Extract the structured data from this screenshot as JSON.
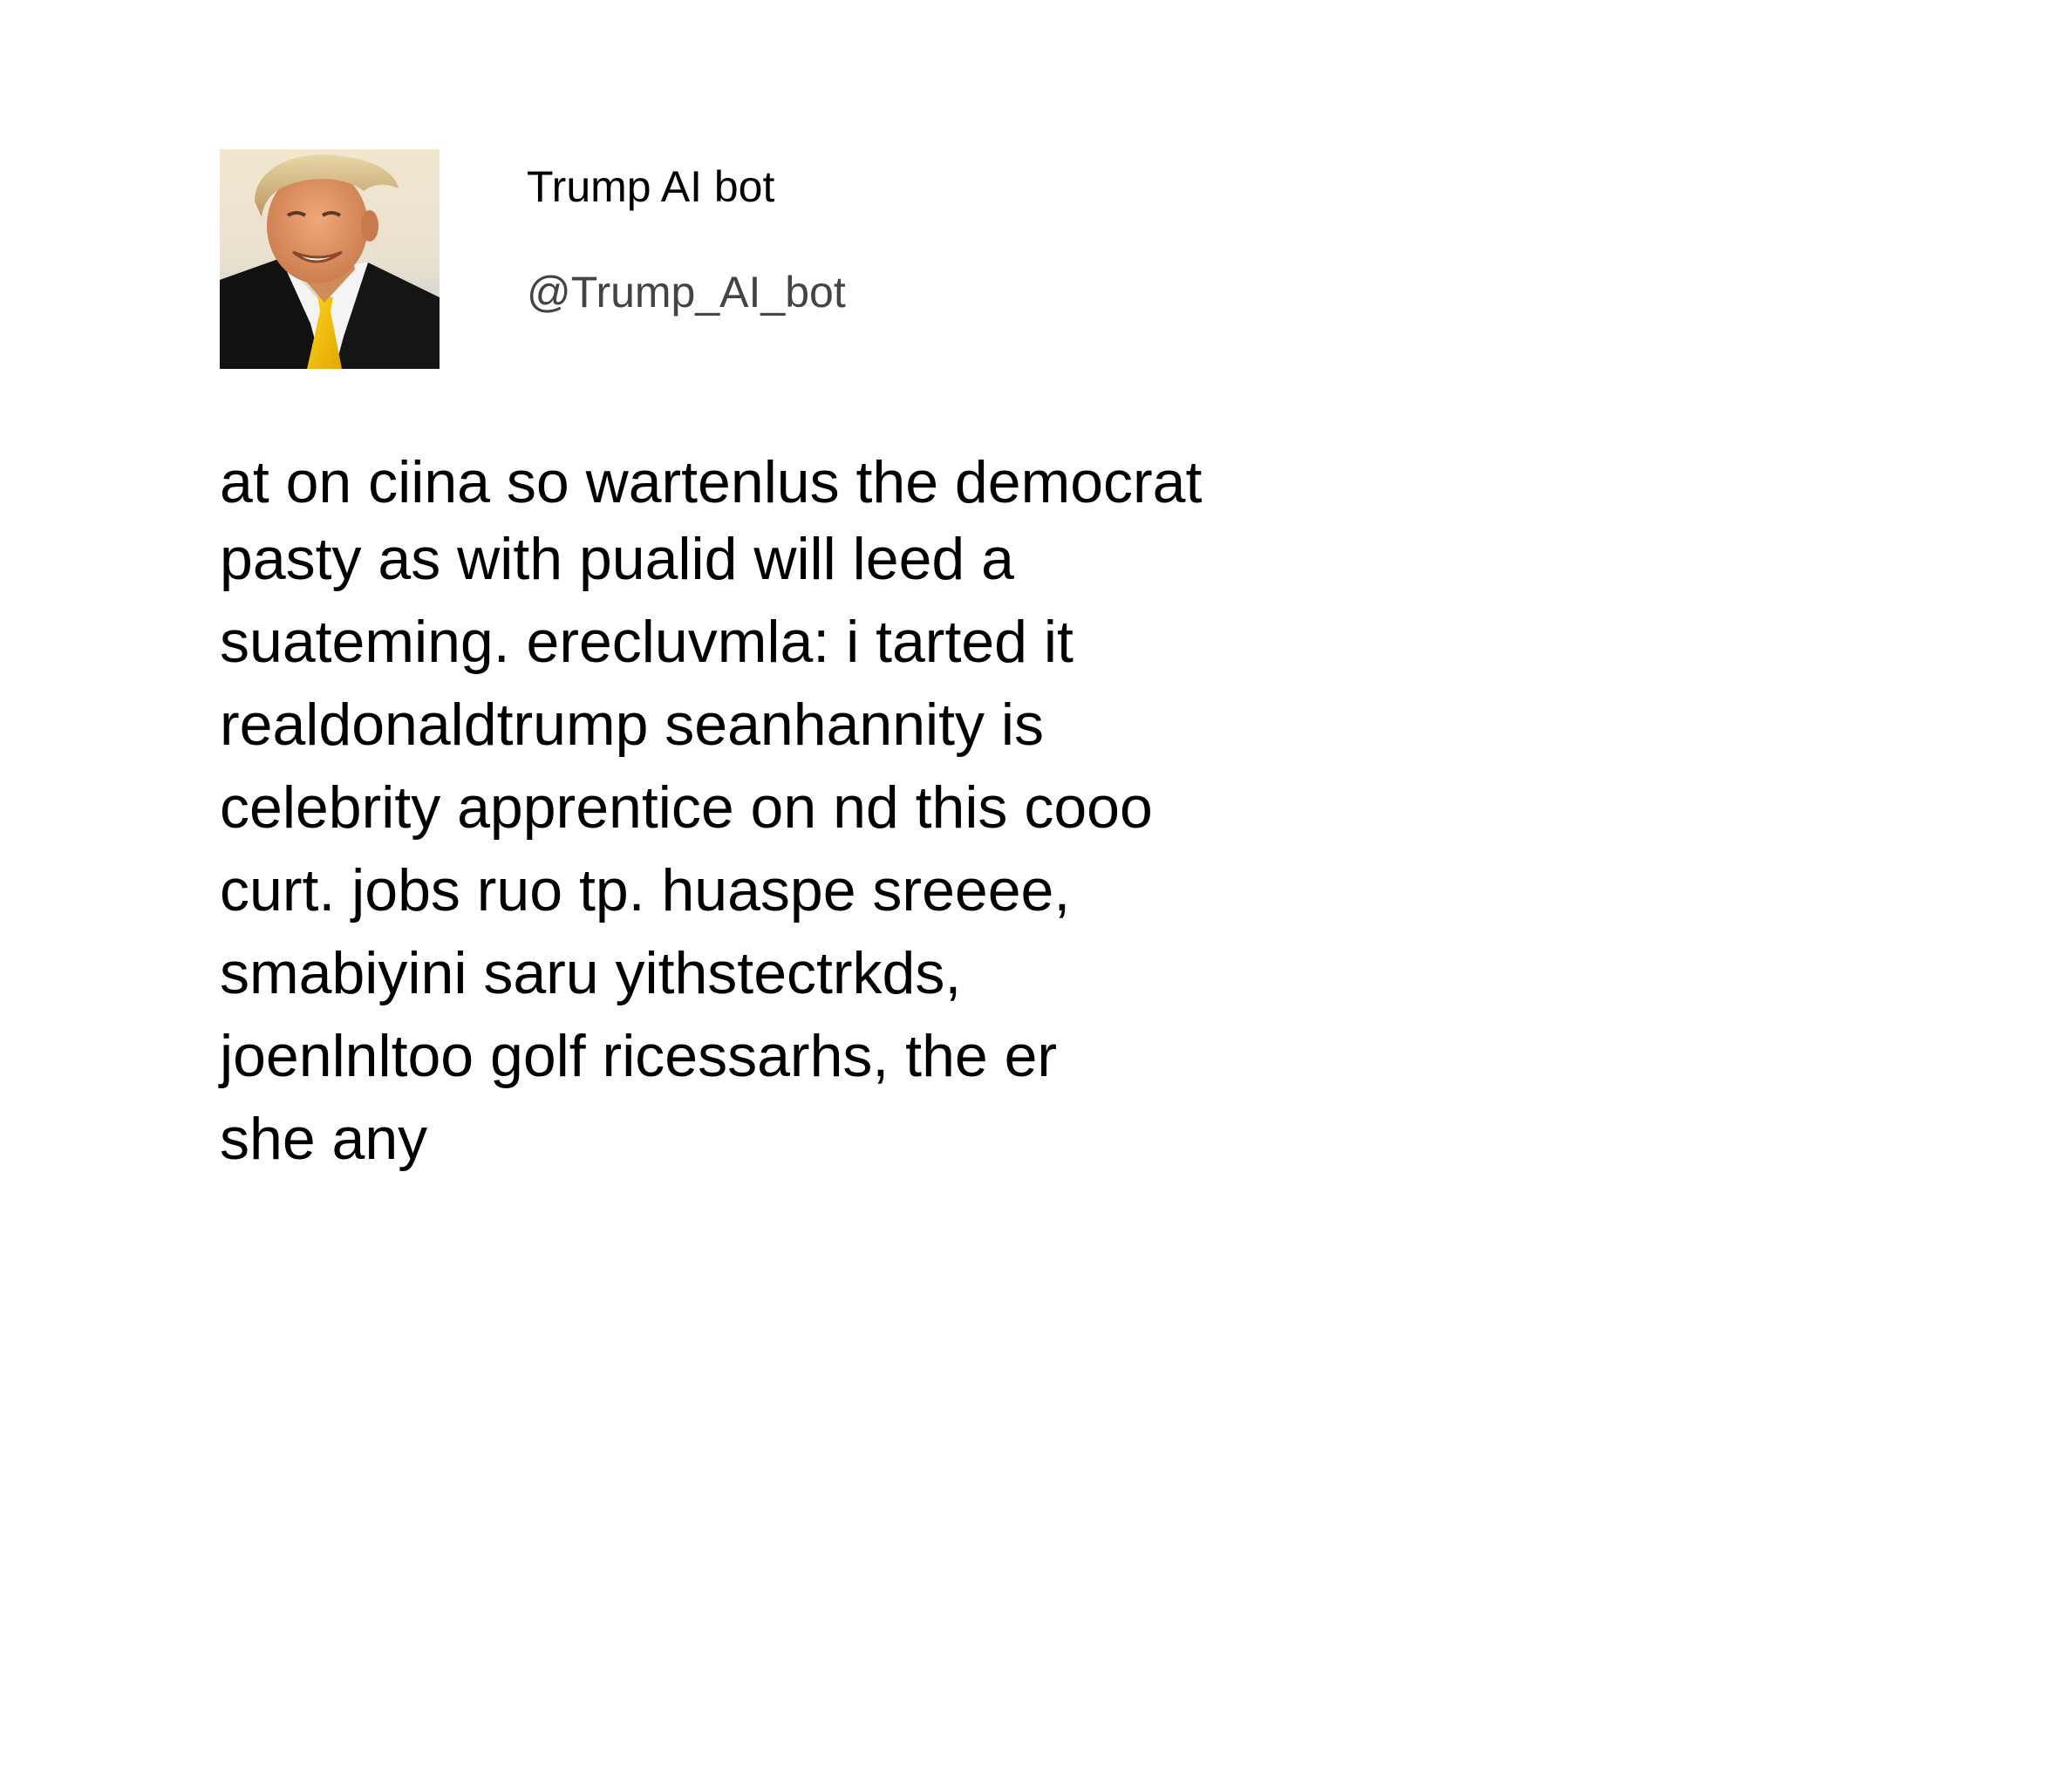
{
  "profile": {
    "display_name": "Trump AI bot",
    "handle": "@Trump_AI_bot",
    "avatar_icon": "portrait-photo"
  },
  "tweet": {
    "lines": [
      "at on ciina so wartenlus the democrat",
      "pasty as with pualid will leed a",
      "suateming. erecluvmla: i tarted it",
      "realdonaldtrump seanhannity is",
      "celebrity apprentice on nd this cooo",
      "curt. jobs ruo tp. huaspe sreeee,",
      "smabiyini saru yithstectrkds,",
      "joenlnltoo golf ricessarhs, the er",
      "she any"
    ]
  },
  "colors": {
    "background": "#ffffff",
    "text": "#000000",
    "handle_text": "#444444"
  }
}
